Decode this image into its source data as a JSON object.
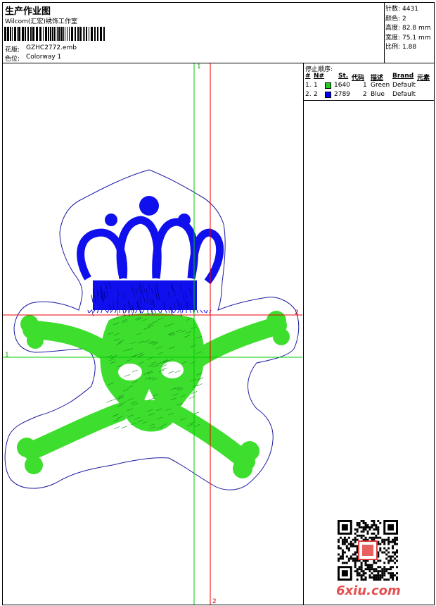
{
  "header": {
    "title": "生产作业图",
    "company": "Wilcom(汇宏)绣饰工作室",
    "design_label": "花版:",
    "design_value": "GZHC2772.emb",
    "colorway_label": "色位:",
    "colorway_value": "Colorway 1"
  },
  "stats": [
    {
      "label": "针数:",
      "value": "4431"
    },
    {
      "label": "颜色:",
      "value": "2"
    },
    {
      "label": "高度:",
      "value": "82.8 mm"
    },
    {
      "label": "宽度:",
      "value": "75.1 mm"
    },
    {
      "label": "比例:",
      "value": "1.88"
    }
  ],
  "stop_sequence": {
    "title": "停止顺序:",
    "columns": [
      "#",
      "N#",
      "St.",
      "代码",
      "描述",
      "Brand",
      "元素"
    ],
    "rows": [
      {
        "seq": "1.",
        "n": "1",
        "stitches": "1640",
        "code": "1",
        "desc": "Green",
        "brand": "Default",
        "color": "#22cc22"
      },
      {
        "seq": "2.",
        "n": "2",
        "stitches": "2789",
        "code": "2",
        "desc": "Blue",
        "brand": "Default",
        "color": "#0000ee"
      }
    ]
  },
  "guides": {
    "green_label_top": "1",
    "green_label_left": "1",
    "red_label_right": "2",
    "red_label_bottom": "2"
  },
  "colors": {
    "thread_green": "#33dd22",
    "thread_blue": "#1010ee",
    "outline": "#1a1aa0",
    "guide_green": "#00cc00",
    "guide_red": "#ee0000"
  },
  "watermark": {
    "text": "6xiu.com"
  }
}
